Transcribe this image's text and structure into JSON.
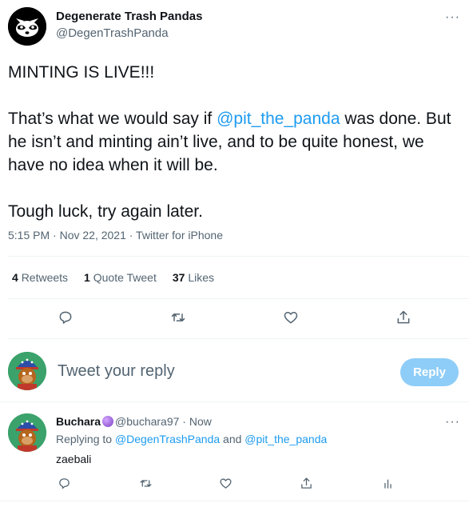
{
  "tweet": {
    "author_name": "Degenerate Trash Pandas",
    "author_handle": "@DegenTrashPanda",
    "more_glyph": "···",
    "line1": "MINTING IS LIVE!!!",
    "p2_before": "That’s what we would say if ",
    "p2_mention": "@pit_the_panda",
    "p2_after": " was done. But he isn’t and minting ain’t live, and to be quite honest, we have no idea when it will be.",
    "line3": "Tough luck, try again later.",
    "meta": "5:15 PM · Nov 22, 2021 · Twitter for iPhone",
    "retweets_count": "4",
    "retweets_label": "Retweets",
    "quotes_count": "1",
    "quotes_label": "Quote Tweet",
    "likes_count": "37",
    "likes_label": "Likes",
    "actions": [
      "reply-icon",
      "retweet-icon",
      "like-icon",
      "share-icon"
    ]
  },
  "composer": {
    "placeholder": "Tweet your reply",
    "reply_button": "Reply"
  },
  "reply": {
    "name": "Buchara",
    "handle_time": "@buchara97 · Now",
    "replying_prefix": "Replying to ",
    "mention1": "@DegenTrashPanda",
    "and": " and ",
    "mention2": "@pit_the_panda",
    "text": "zaebali",
    "more_glyph": "···",
    "actions": [
      "reply-icon",
      "retweet-icon",
      "like-icon",
      "share-icon",
      "analytics-icon"
    ]
  },
  "colors": {
    "accent": "#1d9bf0",
    "reply_button_disabled": "#8ecdf8",
    "secondary_text": "#536471"
  }
}
